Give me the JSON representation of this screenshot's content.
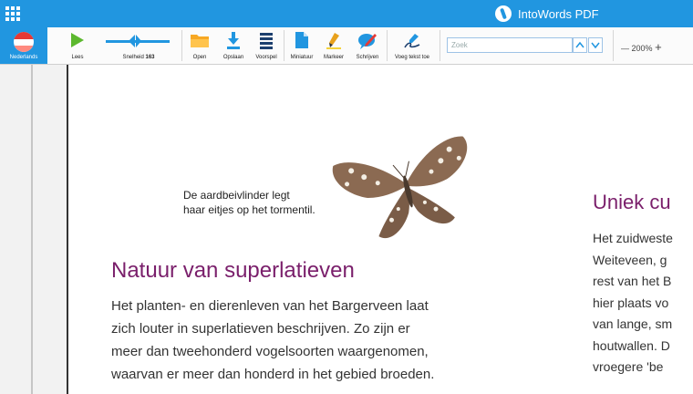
{
  "titlebar": {
    "app_name": "IntoWords PDF"
  },
  "toolbar": {
    "language": "Nederlands",
    "read": "Lees",
    "speed_label": "Snelheid",
    "speed_value": "163",
    "open": "Open",
    "save": "Opslaan",
    "preview": "Voorspel",
    "thumbnail": "Miniatuur",
    "highlight": "Markeer",
    "write": "Schrijven",
    "add_text": "Voeg tekst toe",
    "search_placeholder": "Zoek",
    "zoom": "200%",
    "zoom_out": "—",
    "zoom_in": "+"
  },
  "document": {
    "caption_line1": "De aardbeivlinder legt",
    "caption_line2": "haar eitjes op het tormentil.",
    "heading": "Natuur van superlatieven",
    "paragraph_lines": [
      "Het planten- en dierenleven van het Bargerveen laat",
      "zich louter in superlatieven beschrijven. Zo zijn er",
      "meer dan tweehonderd vogelsoorten waargenomen,",
      "waarvan er meer dan honderd in het gebied broeden."
    ],
    "heading2": "Uniek cu",
    "col2_lines": [
      "Het zuidweste",
      "Weiteveen, g",
      "rest van het B",
      "hier plaats vo",
      "van lange, sm",
      "houtwallen. D",
      "vroegere 'be"
    ]
  },
  "colors": {
    "accent": "#2196e0",
    "heading": "#7a1f6b"
  }
}
